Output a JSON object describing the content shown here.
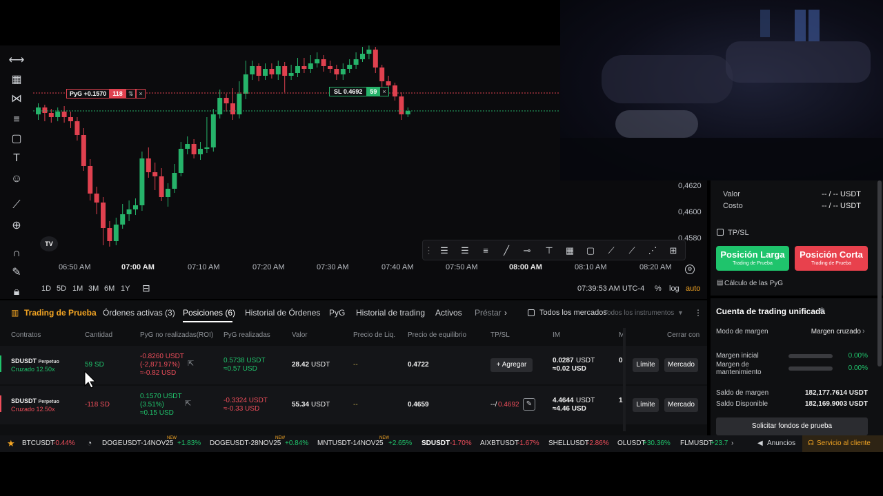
{
  "chart": {
    "price_ticks": [
      "0,4620",
      "0,4600",
      "0,4580"
    ],
    "time_ticks": [
      "06:50 AM",
      "07:00 AM",
      "07:10 AM",
      "07:20 AM",
      "07:30 AM",
      "07:40 AM",
      "07:50 AM",
      "08:00 AM",
      "08:10 AM",
      "08:20 AM"
    ],
    "ranges": [
      "1D",
      "5D",
      "1M",
      "3M",
      "6M",
      "1Y"
    ],
    "clock": "07:39:53 AM UTC-4",
    "pct_label": "%",
    "log_label": "log",
    "auto_label": "auto",
    "pnl_tag": {
      "label": "PyG +0.1570",
      "qty": "118",
      "split": "⇅",
      "close": "×"
    },
    "sl_tag": {
      "label": "SL 0.4692",
      "qty": "59",
      "close": "×"
    },
    "logo": "TV",
    "colors": {
      "up": "#26b36a",
      "down": "#e0414f"
    }
  },
  "right_panel": {
    "valor_label": "Valor",
    "valor_value": "-- / -- USDT",
    "costo_label": "Costo",
    "costo_value": "-- / -- USDT",
    "tpsl_label": "TP/SL",
    "long_button": "Posición Larga",
    "long_sub": "Trading de Prueba",
    "short_button": "Posición Corta",
    "short_sub": "Trading de Prueba",
    "calc_label": "Cálculo de las PyG",
    "account_title": "Cuenta de trading unificada",
    "margin_mode_label": "Modo de margen",
    "margin_mode_value": "Margen cruzado",
    "initial_margin_label": "Margen inicial",
    "initial_margin_value": "0.00%",
    "maint_margin_label_1": "Margen de",
    "maint_margin_label_2": "mantenimiento",
    "maint_margin_value": "0.00%",
    "margin_balance_label": "Saldo de margen",
    "margin_balance_value": "182,177.7614 USDT",
    "available_balance_label": "Saldo Disponible",
    "available_balance_value": "182,169.9003 USDT",
    "request_funds_button": "Solicitar fondos de prueba"
  },
  "bottom": {
    "tabs": [
      "Trading de Prueba",
      "Órdenes activas (3)",
      "Posiciones (6)",
      "Historial de Órdenes",
      "PyG",
      "Historial de trading",
      "Activos",
      "Préstar"
    ],
    "all_markets": "Todos los mercados",
    "all_instruments": "Todos los instrumentos",
    "columns": [
      "Contratos",
      "Cantidad",
      "PyG no realizadas(ROI)",
      "PyG realizadas",
      "Valor",
      "Precio de Liq.",
      "Precio de equilibrio",
      "TP/SL",
      "IM",
      "M",
      "Cerrar con"
    ],
    "rows": [
      {
        "symbol": "SDUSDT",
        "type": "Perpetuo",
        "margin": "Cruzado 12.50x",
        "qty": "59 SD",
        "upnl_1": "-0.8260 USDT",
        "upnl_2": "(-2,871.97%)",
        "upnl_3": "≈-0.82 USD",
        "rpnl_1": "0.5738 USDT",
        "rpnl_2": "≈0.57 USD",
        "value": "28.42",
        "value_unit": "USDT",
        "liq": "--",
        "entry": "0.4722",
        "tpsl": "+ Agregar",
        "im_1": "0.0287",
        "im_unit": "USDT",
        "im_2": "≈0.02 USD",
        "mm": "0.",
        "limit": "Límite",
        "market": "Mercado"
      },
      {
        "symbol": "SDUSDT",
        "type": "Perpetuo",
        "margin": "Cruzado 12.50x",
        "qty": "-118 SD",
        "upnl_1": "0.1570 USDT",
        "upnl_2": "(3.51%)",
        "upnl_3": "≈0.15 USD",
        "rpnl_1": "-0.3324 USDT",
        "rpnl_2": "≈-0.33 USD",
        "value": "55.34",
        "value_unit": "USDT",
        "liq": "--",
        "entry": "0.4659",
        "tpsl_a": "--/",
        "tpsl_b": "0.4692",
        "im_1": "4.4644",
        "im_unit": "USDT",
        "im_2": "≈4.46 USD",
        "mm": "1.",
        "limit": "Límite",
        "market": "Mercado"
      }
    ]
  },
  "ticker": [
    {
      "sym": "BTCUSDT",
      "chg": "-0.44%",
      "dir": "down"
    },
    {
      "sym": "DOGEUSDT-14NOV25",
      "chg": "+1.83%",
      "dir": "up",
      "badge": "NEW"
    },
    {
      "sym": "DOGEUSDT-28NOV25",
      "chg": "+0.84%",
      "dir": "up",
      "badge": "NEW"
    },
    {
      "sym": "MNTUSDT-14NOV25",
      "chg": "+2.65%",
      "dir": "up",
      "badge": "NEW"
    },
    {
      "sym": "SDUSDT",
      "chg": "-1.70%",
      "dir": "down"
    },
    {
      "sym": "AIXBTUSDT",
      "chg": "-1.67%",
      "dir": "down"
    },
    {
      "sym": "SHELLUSDT",
      "chg": "-2.86%",
      "dir": "down"
    },
    {
      "sym": "OLUSDT",
      "chg": "+30.36%",
      "dir": "up"
    },
    {
      "sym": "FLMUSDT",
      "chg": "+23.7",
      "dir": "up"
    }
  ],
  "ticker_right": {
    "announcements": "Anuncios",
    "support": "Servicio al cliente"
  }
}
